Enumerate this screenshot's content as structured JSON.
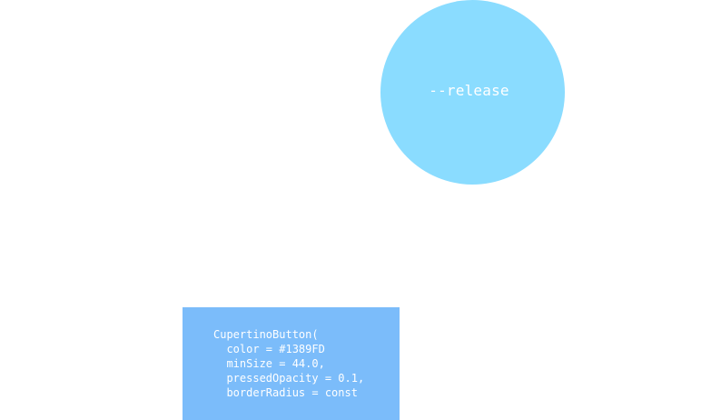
{
  "release_circle": {
    "label": "--release"
  },
  "code_panel": {
    "lines": [
      "CupertinoButton(",
      "  color = #1389FD",
      "  minSize = 44.0,",
      "  pressedOpacity = 0.1,",
      "  borderRadius = const"
    ]
  },
  "colors": {
    "circle": "#8adcff",
    "panel": "#7bbcfa",
    "text": "#ffffff"
  }
}
